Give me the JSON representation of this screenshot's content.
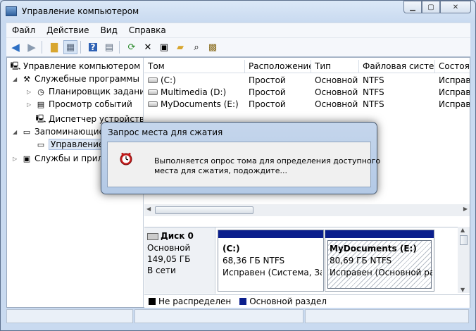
{
  "window": {
    "title": "Управление компьютером"
  },
  "menu": [
    "Файл",
    "Действие",
    "Вид",
    "Справка"
  ],
  "toolbar_icons": [
    "back-arrow-icon",
    "forward-arrow-icon",
    "up-folder-icon",
    "show-hide-tree-icon",
    "help-icon",
    "console-icon",
    "refresh-icon",
    "delete-icon",
    "properties-icon",
    "open-folder-icon",
    "search-icon",
    "export-icon"
  ],
  "tree": {
    "root": "Управление компьютером (л",
    "system_tools": "Служебные программы",
    "task_scheduler": "Планировщик заданий",
    "event_viewer": "Просмотр событий",
    "device_manager": "Диспетчер устройств",
    "storage": "Запоминающие",
    "disk_management": "Управление д",
    "services": "Службы и прило"
  },
  "volumes": {
    "columns": [
      "Том",
      "Расположение",
      "Тип",
      "Файловая систе...",
      "Состоя"
    ],
    "rows": [
      [
        "(C:)",
        "Простой",
        "Основной",
        "NTFS",
        "Исправ"
      ],
      [
        "Multimedia (D:)",
        "Простой",
        "Основной",
        "NTFS",
        "Исправ"
      ],
      [
        "MyDocuments (E:)",
        "Простой",
        "Основной",
        "NTFS",
        "Исправ"
      ]
    ]
  },
  "disk": {
    "name": "Диск 0",
    "type": "Основной",
    "size": "149,05 ГБ",
    "status": "В сети",
    "partitions": [
      {
        "name": "(C:)",
        "size": "68,36 ГБ NTFS",
        "status": "Исправен (Система, Загр"
      },
      {
        "name": "MyDocuments  (E:)",
        "size": "80,69 ГБ NTFS",
        "status": "Исправен (Основной разд"
      }
    ]
  },
  "legend": [
    {
      "label": "Не распределен",
      "color": "#000000"
    },
    {
      "label": "Основной раздел",
      "color": "#0a1e8c"
    }
  ],
  "dialog": {
    "title": "Запрос места для сжатия",
    "line1": "Выполняется опрос тома для определения доступного",
    "line2": "места для сжатия, подождите..."
  }
}
